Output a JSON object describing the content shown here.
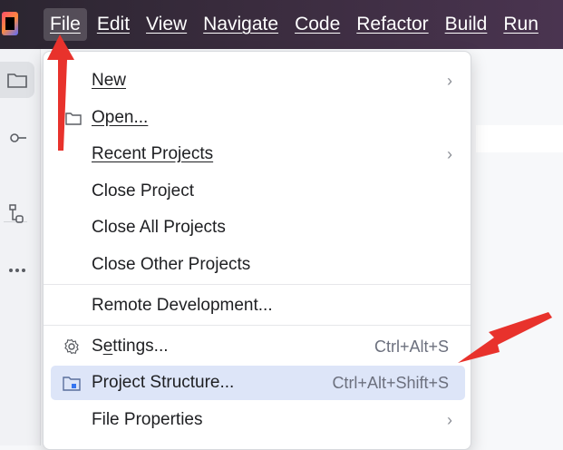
{
  "menubar": {
    "items": [
      {
        "label": "File",
        "active": true
      },
      {
        "label": "Edit"
      },
      {
        "label": "View"
      },
      {
        "label": "Navigate"
      },
      {
        "label": "Code"
      },
      {
        "label": "Refactor"
      },
      {
        "label": "Build"
      },
      {
        "label": "Run"
      }
    ]
  },
  "left_strip": {
    "icons": [
      "folder-icon",
      "commit-icon",
      "structure-icon",
      "more-icon"
    ]
  },
  "file_menu": {
    "items": [
      {
        "label": "New",
        "has_submenu": true
      },
      {
        "label": "Open...",
        "icon": "folder-icon"
      },
      {
        "label": "Recent Projects",
        "has_submenu": true
      },
      {
        "label": "Close Project"
      },
      {
        "label": "Close All Projects"
      },
      {
        "label": "Close Other Projects"
      },
      {
        "label": "Remote Development..."
      },
      {
        "label": "Settings...",
        "icon": "gear-icon",
        "shortcut": "Ctrl+Alt+S"
      },
      {
        "label": "Project Structure...",
        "icon": "project-structure-icon",
        "shortcut": "Ctrl+Alt+Shift+S",
        "highlighted": true
      },
      {
        "label": "File Properties",
        "has_submenu": true
      }
    ]
  },
  "colors": {
    "annotation_arrow": "#e8322c",
    "highlight": "#dde5f8",
    "titlebar": "#3a2c3e"
  }
}
